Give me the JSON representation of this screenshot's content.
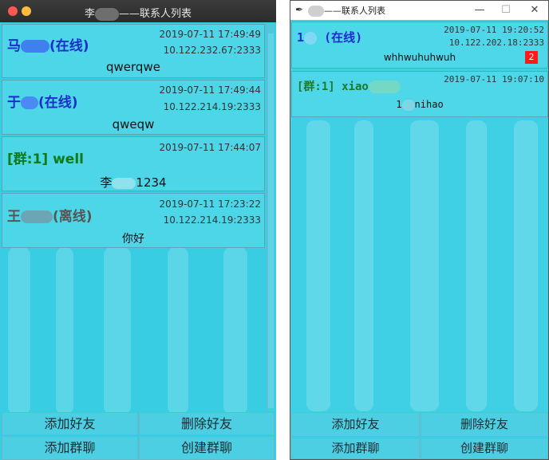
{
  "left_window": {
    "title_prefix": "李",
    "title_suffix": "——联系人列表",
    "contacts": [
      {
        "name": "马",
        "status": "(在线)",
        "time": "2019-07-11 17:49:49",
        "ip": "10.122.232.67:2333",
        "message": "qwerqwe",
        "color": "#1a2ecc"
      },
      {
        "name": "于",
        "status": "(在线)",
        "time": "2019-07-11 17:49:44",
        "ip": "10.122.214.19:2333",
        "message": "qweqw",
        "color": "#1a2ecc"
      },
      {
        "name": "[群:1] well",
        "status": "",
        "time": "2019-07-11 17:44:07",
        "ip": "",
        "message_prefix": "李",
        "message": "1234",
        "color": "#0f7a1a"
      },
      {
        "name": "王",
        "status": "(离线)",
        "time": "2019-07-11 17:23:22",
        "ip": "10.122.214.19:2333",
        "message": "你好",
        "color": "#555555"
      }
    ],
    "buttons": {
      "add_friend": "添加好友",
      "delete_friend": "删除好友",
      "add_group": "添加群聊",
      "create_group": "创建群聊"
    }
  },
  "right_window": {
    "title": "——联系人列表",
    "controls": {
      "minimize": "—",
      "maximize": "☐",
      "close": "✕"
    },
    "contacts": [
      {
        "name": "1",
        "status": "(在线)",
        "time": "2019-07-11 19:20:52",
        "ip": "10.122.202.18:2333",
        "message": "whhwuhuhwuh",
        "badge": "2",
        "color": "#1a2ecc"
      },
      {
        "name": "[群:1] xiao",
        "status": "",
        "time": "2019-07-11 19:07:10",
        "ip": "",
        "message_prefix": "1",
        "message": "nihao",
        "color": "#1f7a2a"
      }
    ],
    "buttons": {
      "add_friend": "添加好友",
      "delete_friend": "删除好友",
      "add_group": "添加群聊",
      "create_group": "创建群聊"
    }
  },
  "colors": {
    "window_bg": "#38cde3",
    "badge": "#ff1a1a"
  }
}
